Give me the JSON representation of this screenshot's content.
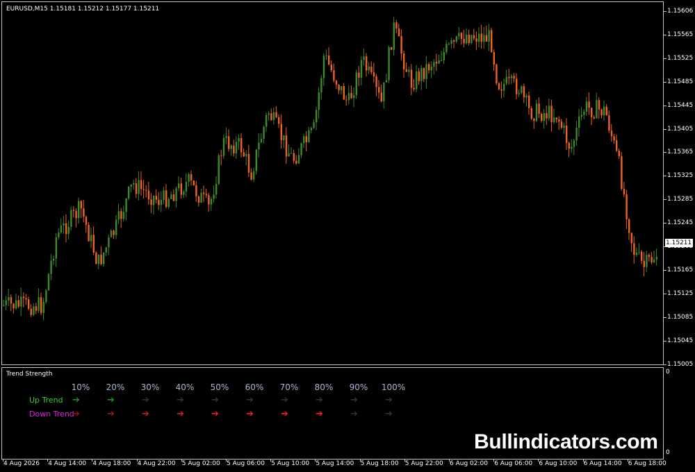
{
  "chart": {
    "symbol_label": "EURUSD,M15  1.15181 1.15212 1.15177 1.15211",
    "current_price": "1.15211",
    "up_color": "#3c8a28",
    "down_color": "#f0641e",
    "price_axis": [
      "1.15606",
      "1.15565",
      "1.15525",
      "1.15485",
      "1.15445",
      "1.15405",
      "1.15365",
      "1.15325",
      "1.15285",
      "1.15245",
      "1.15205",
      "1.15165",
      "1.15125",
      "1.15085",
      "1.15045",
      "1.15005"
    ],
    "time_axis": [
      "4 Aug 2026",
      "4 Aug 14:00",
      "4 Aug 18:00",
      "4 Aug 22:00",
      "5 Aug 02:00",
      "5 Aug 06:00",
      "5 Aug 10:00",
      "5 Aug 14:00",
      "5 Aug 18:00",
      "5 Aug 22:00",
      "6 Aug 02:00",
      "6 Aug 06:00",
      "6 Aug 10:00",
      "6 Aug 14:00",
      "6 Aug 18:00"
    ]
  },
  "indicator": {
    "title": "Trend Strength",
    "scale_top": "0",
    "scale_bottom": "0",
    "percent_labels": [
      "10%",
      "20%",
      "30%",
      "40%",
      "50%",
      "60%",
      "70%",
      "80%",
      "90%",
      "100%"
    ],
    "up_label": "Up Trend",
    "down_label": "Down Trend",
    "up_label_color": "#32cd32",
    "down_label_color": "#e020e0",
    "arrow_glyph": "➔",
    "up_strength_pct": 20,
    "down_strength_pct": 80,
    "up_arrow_colors": [
      "#1e8c1e",
      "#1e8c1e",
      "#323232",
      "#323232",
      "#323232",
      "#323232",
      "#323232",
      "#323232",
      "#323232",
      "#323232"
    ],
    "down_arrow_colors": [
      "#8c1414",
      "#a01414",
      "#c81e1e",
      "#dc1e1e",
      "#f01e2d",
      "#f51e2d",
      "#ff1e1e",
      "#ff1e1e",
      "#323232",
      "#323232"
    ]
  },
  "watermark": "Bullindicators.com"
}
